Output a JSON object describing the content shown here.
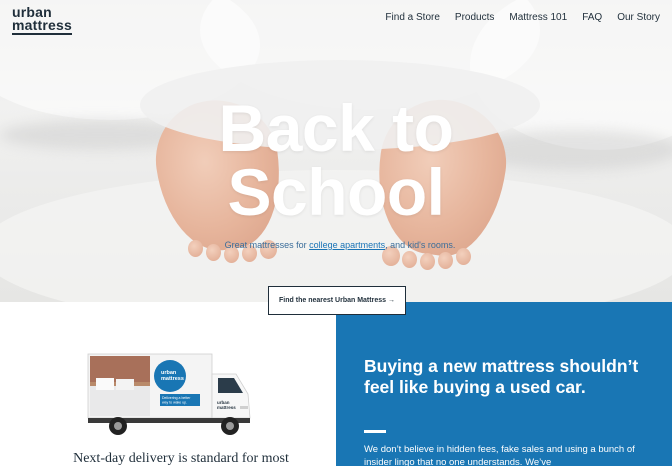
{
  "brand": {
    "line1": "urban",
    "line2": "mattress"
  },
  "nav": {
    "items": [
      "Find a Store",
      "Products",
      "Mattress 101",
      "FAQ",
      "Our Story"
    ]
  },
  "hero": {
    "title_line1": "Back to",
    "title_line2": "School",
    "subtitle_prefix": "Great mattresses for ",
    "subtitle_link1": "college apartments",
    "subtitle_mid": ", and kid's rooms.",
    "cta_label": "Find the nearest Urban Mattress →"
  },
  "delivery": {
    "truck_brand_line1": "urban",
    "truck_brand_line2": "mattress",
    "truck_slogan": "Delivering a better way to wake up.",
    "caption": "Next-day delivery is standard for most"
  },
  "promise": {
    "heading": "Buying a new mattress shouldn’t feel like buying a used car.",
    "body": "We don’t believe in hidden fees, fake sales and using a bunch of insider lingo that no one understands. We’ve"
  },
  "colors": {
    "accent_blue": "#1976b4",
    "navy_text": "#1f2e3a"
  }
}
